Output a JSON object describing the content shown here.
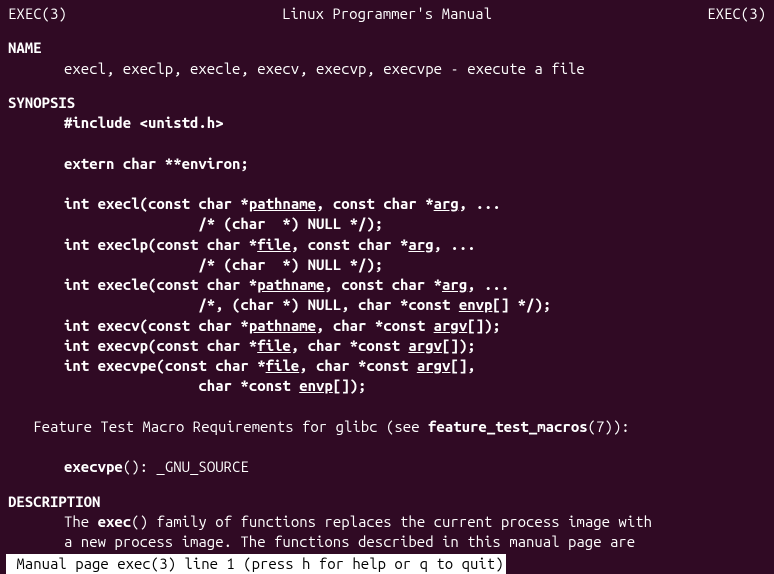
{
  "header": {
    "left": "EXEC(3)",
    "center": "Linux Programmer's Manual",
    "right": "EXEC(3)"
  },
  "sections": {
    "name_head": "NAME",
    "name_text": "execl, execlp, execle, execv, execvp, execvpe - execute a file",
    "synopsis_head": "SYNOPSIS",
    "include_hash": "#include <unistd.h>",
    "extern_kw": "extern char **environ;",
    "execl": {
      "p1": "int execl(const char *",
      "u1": "pathname",
      "p2": ", const char *",
      "u2": "arg",
      "p3": ", ..."
    },
    "execl2": "                /* (char  *) NULL */);",
    "execlp": {
      "p1": "int execlp(const char *",
      "u1": "file",
      "p2": ", const char *",
      "u2": "arg",
      "p3": ", ..."
    },
    "execlp2": "                /* (char  *) NULL */);",
    "execle": {
      "p1": "int execle(const char *",
      "u1": "pathname",
      "p2": ", const char *",
      "u2": "arg",
      "p3": ", ..."
    },
    "execle2": {
      "p1": "                /*, (char *) NULL, char *const ",
      "u1": "envp",
      "p2": "[] */);"
    },
    "execv": {
      "p1": "int execv(const char *",
      "u1": "pathname",
      "p2": ", char *const ",
      "u2": "argv",
      "p3": "[]);"
    },
    "execvp": {
      "p1": "int execvp(const char *",
      "u1": "file",
      "p2": ", char *const ",
      "u2": "argv",
      "p3": "[]);"
    },
    "execvpe": {
      "p1": "int execvpe(const char *",
      "u1": "file",
      "p2": ", char *const ",
      "u2": "argv",
      "p3": "[],"
    },
    "execvpe2": {
      "p1": "                char *const ",
      "u1": "envp",
      "p2": "[]);"
    },
    "feature_pre": "   Feature Test Macro Requirements for glibc (see ",
    "feature_bold": "feature_test_macros",
    "feature_post": "(7)):",
    "execvpe_req_pre": "execvpe",
    "execvpe_req_post": "(): _GNU_SOURCE",
    "description_head": "DESCRIPTION",
    "desc_pre": "The ",
    "desc_bold": "exec",
    "desc_post1": "() family of functions replaces the current process image with",
    "desc_line2": "a new process image.  The functions described in this manual page  are"
  },
  "statusbar": " Manual page exec(3) line 1 (press h for help or q to quit)"
}
